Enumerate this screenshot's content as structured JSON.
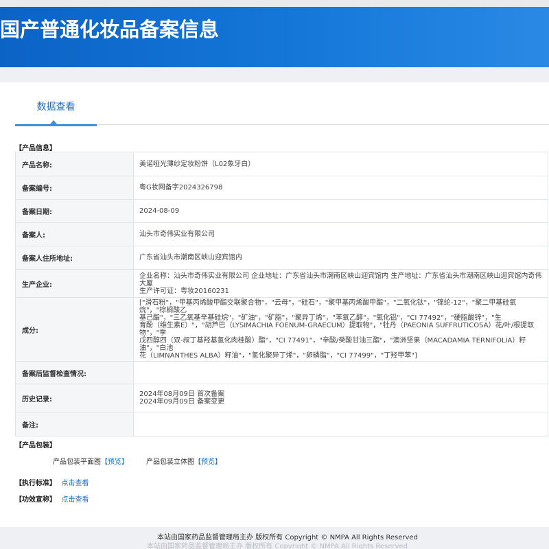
{
  "header": {
    "title": "国产普通化妆品备案信息"
  },
  "tabs": [
    {
      "label": "数据查看"
    }
  ],
  "sections": {
    "product_info": "【产品信息】",
    "packaging": "【产品包装】",
    "standard": "【执行标准】",
    "efficacy": "【功效宣称】"
  },
  "product_info": {
    "rows": [
      {
        "key": "产品名称:",
        "lines": [
          "美诺哑光薄纱定妆粉饼（L02象牙白）"
        ]
      },
      {
        "key": "备案编号:",
        "lines": [
          "粤G妆网备字2024326798"
        ]
      },
      {
        "key": "备案日期:",
        "lines": [
          "2024-08-09"
        ]
      },
      {
        "key": "备案人:",
        "lines": [
          "汕头市奇伟实业有限公司"
        ]
      },
      {
        "key": "备案人住所地址:",
        "lines": [
          "广东省汕头市潮南区峡山迎宾馆内"
        ]
      },
      {
        "key": "生产企业:",
        "lines": [
          "企业名称：汕头市奇伟实业有限公司 企业地址：广东省汕头市潮南区峡山迎宾馆内 生产地址：广东省汕头市潮南区峡山迎宾馆内奇伟大厦",
          "生产许可证：粤妆20160231"
        ]
      },
      {
        "key": "成分:",
        "lines": [
          "[\"滑石粉\"，\"甲基丙烯酸甲酯交联聚合物\"，\"云母\"，\"硅石\"，\"聚甲基丙烯酸甲酯\"，\"二氧化钛\"，\"锦纶-12\"，\"聚二甲基硅氧烷\"，\"棕榈酸乙",
          "基己酯\"，\"三乙氧基辛基硅烷\"，\"矿油\"，\"矿脂\"，\"聚异丁烯\"，\"苯氧乙醇\"，\"氧化铝\"，\"CI 77492\"，\"硬脂酸锌\"，\"生",
          "育酚（维生素E）\"，\"胡芦巴（LYSIMACHIA FOENUM-GRAECUM）提取物\"，\"牡丹（PAEONIA SUFFRUTICOSA）花/叶/根提取物\"，\"季",
          "戊四醇四（双-叔丁基羟基氢化肉桂酸）酯\"，\"CI 77491\"，\"辛酸/癸酸甘油三酯\"，\"澳洲坚果（MACADAMIA TERNIFOLIA）籽油\"，\"白池",
          "花（LIMNANTHES ALBA）籽油\"，\"氢化聚异丁烯\"，\"卵磷脂\"，\"CI 77499\"，\"丁羟甲苯\"]"
        ]
      },
      {
        "key": "备案后监督检查情况:",
        "lines": []
      },
      {
        "key": "历史记录:",
        "lines": [
          "2024年08月09日 首次备案",
          "2024年09月09日 备案变更"
        ]
      },
      {
        "key": "备注:",
        "lines": []
      }
    ]
  },
  "packaging": {
    "flat_label": "产品包装平面图",
    "stereo_label": "产品包装立体图",
    "preview_link": "【预览】"
  },
  "links": {
    "view": "点击查看"
  },
  "footer": {
    "text": "本站由国家药品监督管理局主办 版权所有 Copyright © NMPA All Rights Reserved"
  }
}
